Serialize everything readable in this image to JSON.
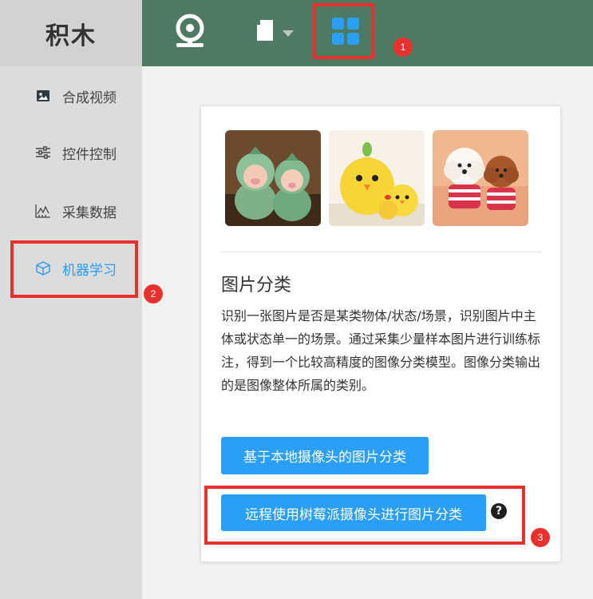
{
  "app": {
    "title": "积木"
  },
  "toolbar": {
    "camera_icon": "webcam-icon",
    "file_icon": "file-icon",
    "apps_icon": "grid-apps-icon"
  },
  "sidebar": {
    "items": [
      {
        "label": "合成视频",
        "icon": "image-icon"
      },
      {
        "label": "控件控制",
        "icon": "sliders-icon"
      },
      {
        "label": "采集数据",
        "icon": "chart-icon"
      },
      {
        "label": "机器学习",
        "icon": "cube-icon",
        "active": true
      }
    ]
  },
  "card": {
    "title": "图片分类",
    "description": "识别一张图片是否是某类物体/状态/场景，识别图片中主体或状态单一的场景。通过采集少量样本图片进行训练标注，得到一个比较高精度的图像分类模型。图像分类输出的是图像整体所属的类别。",
    "local_button": "基于本地摄像头的图片分类",
    "remote_button": "远程使用树莓派摄像头进行图片分类",
    "help": "?"
  },
  "annotations": {
    "badge1": "1",
    "badge2": "2",
    "badge3": "3"
  },
  "colors": {
    "topbar": "#4e7a64",
    "accent": "#2a9ff5",
    "highlight": "#e8312f",
    "sidebar": "#dcdcdc"
  }
}
